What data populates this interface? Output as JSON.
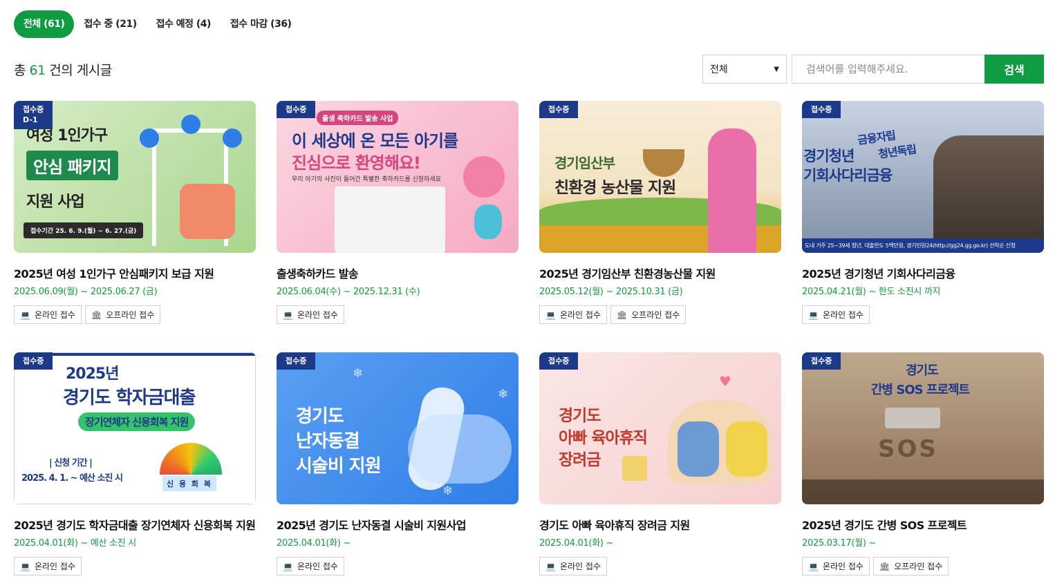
{
  "tabs": [
    {
      "label": "전체 (61)",
      "active": true
    },
    {
      "label": "접수 중 (21)",
      "active": false
    },
    {
      "label": "접수 예정 (4)",
      "active": false
    },
    {
      "label": "접수 마감 (36)",
      "active": false
    }
  ],
  "summary": {
    "prefix": "총",
    "count": "61",
    "suffix": "건의 게시글"
  },
  "search": {
    "select_value": "전체",
    "placeholder": "검색어를 입력해주세요.",
    "button_label": "검색"
  },
  "colors": {
    "accent": "#0f9b3f",
    "badge": "#1d3a8a"
  },
  "cards": [
    {
      "badge": "접수중",
      "badge_sub": "D-1",
      "thumb_text": [
        "여성 1인가구",
        "안심 패키지",
        "지원 사업",
        "접수기간  25. 6. 9.(월) ~ 6. 27.(금)"
      ],
      "title": "2025년 여성 1인가구 안심패키지 보급 지원",
      "date": "2025.06.09(월) ~ 2025.06.27 (금)",
      "chips": [
        {
          "icon": "laptop-icon",
          "label": "온라인 접수"
        },
        {
          "icon": "building-icon",
          "label": "오프라인 접수"
        }
      ]
    },
    {
      "badge": "접수중",
      "thumb_text": [
        "출생 축하카드 발송 사업",
        "이 세상에 온 모든 아기를",
        "진심으로 환영해요!",
        "우리 아기의 사진이 들어간 특별한 축하카드를 신청하세요"
      ],
      "title": "출생축하카드 발송",
      "date": "2025.06.04(수) ~ 2025.12.31 (수)",
      "chips": [
        {
          "icon": "laptop-icon",
          "label": "온라인 접수"
        }
      ]
    },
    {
      "badge": "접수중",
      "thumb_text": [
        "경기임산부",
        "친환경 농산물 지원"
      ],
      "title": "2025년 경기임산부 친환경농산물 지원",
      "date": "2025.05.12(월) ~ 2025.10.31 (금)",
      "chips": [
        {
          "icon": "laptop-icon",
          "label": "온라인 접수"
        },
        {
          "icon": "building-icon",
          "label": "오프라인 접수"
        }
      ]
    },
    {
      "badge": "접수중",
      "thumb_text": [
        "금융자립",
        "청년독립",
        "경기청년",
        "기회사다리금융",
        "도내 거주 25~39세 청년, 대출한도 5백만원, 경기민원24(http://gg24.gg.go.kr) 선착순 신청"
      ],
      "title": "2025년 경기청년 기회사다리금융",
      "date": "2025.04.21(월) ~ 한도 소진시 까지",
      "chips": [
        {
          "icon": "laptop-icon",
          "label": "온라인 접수"
        }
      ]
    },
    {
      "badge": "접수중",
      "thumb_text": [
        "2025년",
        "경기도 학자금대출",
        "장기연체자 신용회복 지원",
        "| 신청 기간 |",
        "2025. 4. 1. ~ 예산 소진 시",
        "신 용 회 복"
      ],
      "title": "2025년 경기도 학자금대출 장기연체자 신용회복 지원",
      "date": "2025.04.01(화) ~ 예산 소진 시",
      "chips": [
        {
          "icon": "laptop-icon",
          "label": "온라인 접수"
        }
      ]
    },
    {
      "badge": "접수중",
      "thumb_text": [
        "경기도",
        "난자동결",
        "시술비 지원"
      ],
      "title": "2025년 경기도 난자동결 시술비 지원사업",
      "date": "2025.04.01(화) ~",
      "chips": [
        {
          "icon": "laptop-icon",
          "label": "온라인 접수"
        }
      ]
    },
    {
      "badge": "접수중",
      "thumb_text": [
        "경기도",
        "아빠 육아휴직",
        "장려금"
      ],
      "title": "경기도 아빠 육아휴직 장려금 지원",
      "date": "2025.04.01(화) ~",
      "chips": [
        {
          "icon": "laptop-icon",
          "label": "온라인 접수"
        }
      ]
    },
    {
      "badge": "접수중",
      "thumb_text": [
        "경기도",
        "간병 SOS 프로젝트",
        "SOS"
      ],
      "title": "2025년 경기도 간병 SOS 프로젝트",
      "date": "2025.03.17(월) ~",
      "chips": [
        {
          "icon": "laptop-icon",
          "label": "온라인 접수"
        },
        {
          "icon": "building-icon",
          "label": "오프라인 접수"
        }
      ]
    }
  ]
}
